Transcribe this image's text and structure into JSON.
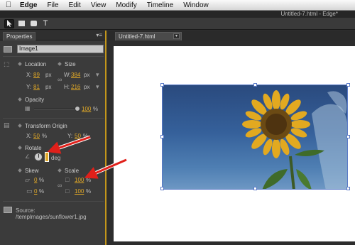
{
  "menubar": {
    "app_name": "Edge",
    "items": [
      "File",
      "Edit",
      "View",
      "Modify",
      "Timeline",
      "Window"
    ]
  },
  "window": {
    "title": "Untitled-7.html - Edge*"
  },
  "properties": {
    "tab_label": "Properties",
    "element_name": "Image1",
    "location": {
      "label": "Location",
      "x_label": "X:",
      "x_value": "89",
      "x_unit": "px",
      "y_label": "Y:",
      "y_value": "81",
      "y_unit": "px"
    },
    "size": {
      "label": "Size",
      "w_label": "W:",
      "w_value": "384",
      "w_unit": "px",
      "h_label": "H:",
      "h_value": "216",
      "h_unit": "px"
    },
    "opacity": {
      "label": "Opacity",
      "value": "100",
      "unit": "%",
      "level": 1.0
    },
    "transform_origin": {
      "label": "Transform Origin",
      "x_label": "X:",
      "x_value": "50",
      "x_unit": "%",
      "y_label": "Y:",
      "y_value": "50",
      "y_unit": "%"
    },
    "rotate": {
      "label": "Rotate",
      "value": "0",
      "unit": "deg"
    },
    "skew": {
      "label": "Skew",
      "x_value": "0",
      "y_value": "0",
      "unit": "%"
    },
    "scale": {
      "label": "Scale",
      "x_value": "100",
      "y_value": "100",
      "unit": "%"
    },
    "source": {
      "label": "Source:",
      "path": "/templmages/sunflower1.jpg"
    }
  },
  "stage": {
    "tab_label": "Untitled-7.html"
  },
  "annotations": {
    "arrow_color": "#e0201a",
    "accent": "#e0a827"
  }
}
